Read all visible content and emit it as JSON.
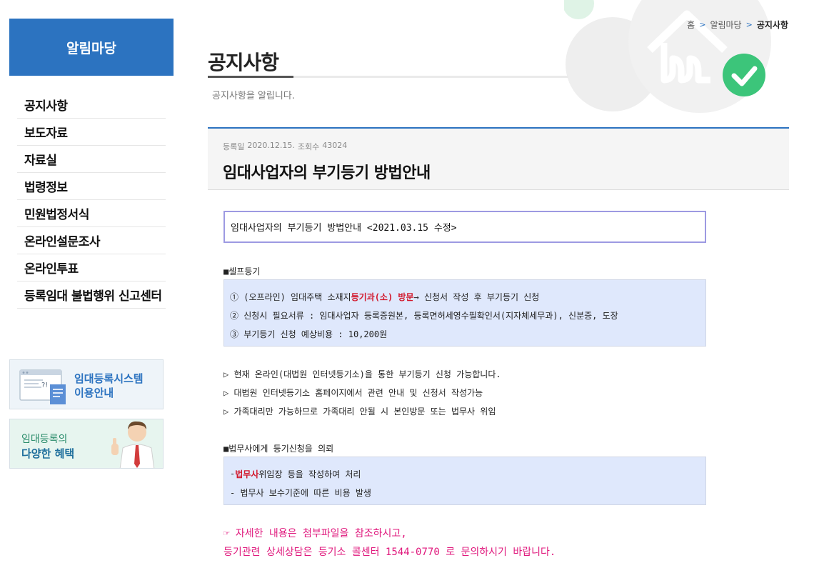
{
  "sidebar": {
    "title": "알림마당",
    "items": [
      "공지사항",
      "보도자료",
      "자료실",
      "법령정보",
      "민원법정서식",
      "온라인설문조사",
      "온라인투표",
      "등록임대 불법행위 신고센터"
    ]
  },
  "banners": {
    "system": {
      "line1": "임대등록시스템",
      "line2": "이용안내"
    },
    "benefit": {
      "line1": "임대등록의",
      "line2": "다양한 혜택"
    }
  },
  "breadcrumb": {
    "home": "홈",
    "sep": ">",
    "section": "알림마당",
    "current": "공지사항"
  },
  "page": {
    "title": "공지사항",
    "subtitle": "공지사항을 알립니다."
  },
  "article": {
    "date_label": "등록일",
    "date": "2020.12.15.",
    "views_label": "조회수",
    "views": "43024",
    "title": "임대사업자의 부기등기 방법안내"
  },
  "content": {
    "headline": "임대사업자의 부기등기 방법안내 <2021.03.15 수정>",
    "self": {
      "label": "■셀프등기",
      "line1_a": "① (오프라인) 임대주택 소재지 ",
      "line1_red": "등기과(소) 방문",
      "line1_b": " → 신청서 작성 후 부기등기 신청",
      "line2": "② 신청시 필요서류 : 임대사업자 등록증원본, 등록면허세영수필확인서(지자체세무과), 신분증, 도장",
      "line3": "③ 부기등기 신청 예상비용 : 10,200원"
    },
    "bullets": [
      "▷ 현재 온라인(대법원 인터넷등기소)을 통한 부기등기 신청 가능합니다.",
      "▷ 대법원 인터넷등기소 홈페이지에서 관련 안내 및 신청서 작성가능",
      "▷ 가족대리만 가능하므로 가족대리 안될 시 본인방문 또는 법무사 위임"
    ],
    "lawyer": {
      "label": "■법무사에게 등기신청을 의뢰",
      "line1_a": "- ",
      "line1_red": "법무사",
      "line1_b": " 위임장 등을 작성하여 처리",
      "line2": "- 법무사 보수기준에 따른 비용 발생"
    },
    "notice1": "☞ 자세한 내용은 첨부파일을 참조하시고,",
    "notice2": "등기관련 상세상담은 등기소 콜센터 1544-0770 로 문의하시기 바랍니다."
  },
  "colors": {
    "primary": "#2c73c0",
    "highlight_red": "#d2182c",
    "notice_pink": "#e0197d",
    "box_blue": "#dfe8fc",
    "headline_border": "#9d9ae2"
  }
}
